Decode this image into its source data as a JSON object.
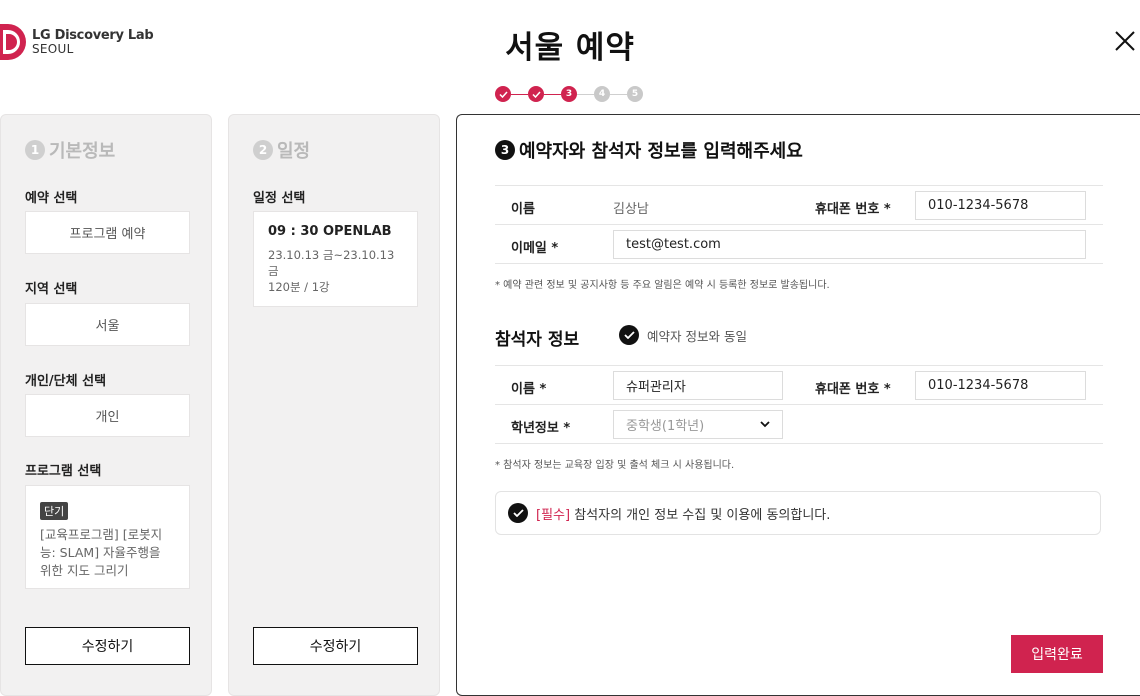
{
  "brand": {
    "line1": "LG Discovery Lab",
    "line2": "SEOUL",
    "accent": "#d0234f"
  },
  "page": {
    "title": "서울 예약"
  },
  "stepper": {
    "steps": [
      "",
      "",
      "3",
      "4",
      "5"
    ],
    "current": 3
  },
  "panel1": {
    "number": "1",
    "title": "기본정보",
    "reservation_label": "예약 선택",
    "reservation_value": "프로그램 예약",
    "region_label": "지역 선택",
    "region_value": "서울",
    "type_label": "개인/단체 선택",
    "type_value": "개인",
    "program_label": "프로그램 선택",
    "program_badge": "단기",
    "program_name": "[교육프로그램] [로봇지능: SLAM] 자율주행을 위한 지도 그리기",
    "edit_label": "수정하기"
  },
  "panel2": {
    "number": "2",
    "title": "일정",
    "schedule_label": "일정 선택",
    "schedule_title": "09 : 30 OPENLAB",
    "schedule_dates": "23.10.13 금~23.10.13 금",
    "schedule_duration": "120분 / 1강",
    "edit_label": "수정하기"
  },
  "main": {
    "number": "3",
    "title": "예약자와 참석자 정보를 입력해주세요",
    "booker": {
      "name_label": "이름",
      "name_value": "김상남",
      "phone_label": "휴대폰 번호 *",
      "phone_value": "010-1234-5678",
      "email_label": "이메일 *",
      "email_value": "test@test.com"
    },
    "booker_note": "*  예약 관련 정보 및 공지사항 등 주요 알림은 예약 시 등록한 정보로 발송됩니다.",
    "attendee_title": "참석자 정보",
    "same_as_booker": "예약자 정보와 동일",
    "attendee": {
      "name_label": "이름 *",
      "name_value": "슈퍼관리자",
      "phone_label": "휴대폰 번호 *",
      "phone_value": "010-1234-5678",
      "grade_label": "학년정보 *",
      "grade_value": "중학생(1학년)"
    },
    "attendee_note": "*  참석자 정보는 교육장 입장 및 출석 체크 시 사용됩니다.",
    "agree_required": "[필수]",
    "agree_text": " 참석자의 개인 정보 수집 및 이용에 동의합니다.",
    "submit_label": "입력완료"
  }
}
